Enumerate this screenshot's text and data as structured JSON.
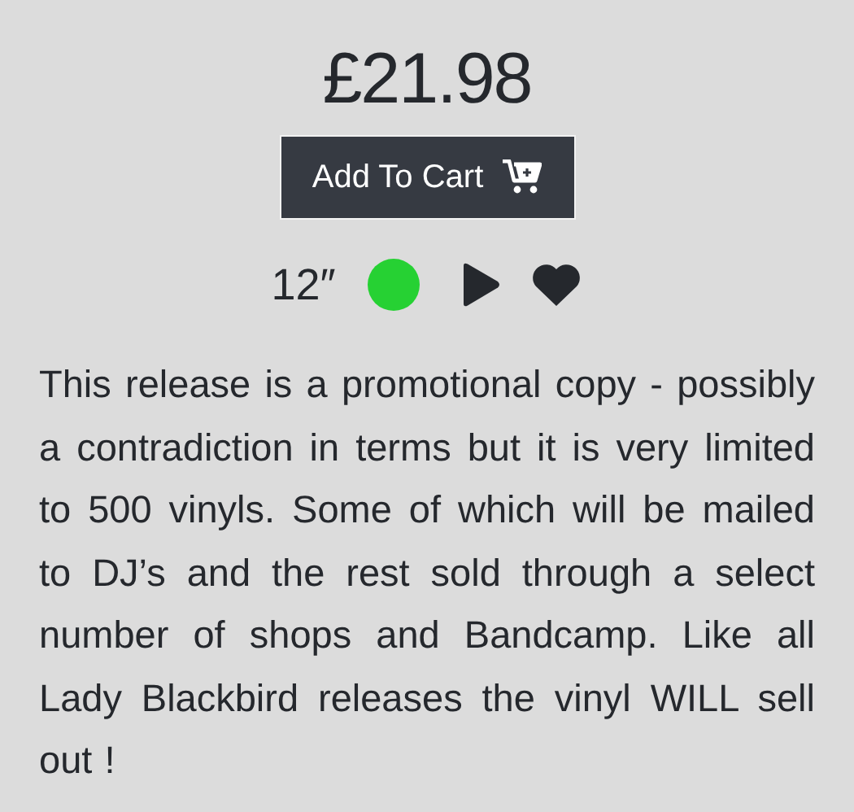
{
  "price": "£21.98",
  "add_to_cart": {
    "label": "Add To Cart"
  },
  "format": {
    "label": "12″",
    "color": "#26d133"
  },
  "description": "This release is a promotional copy - possibly a contradiction in terms but it is very limited to 500 vinyls. Some of which will be mailed to DJ’s and the rest sold through a select number of shops and Bandcamp. Like all Lady Blackbird releases the vinyl WILL sell out !"
}
